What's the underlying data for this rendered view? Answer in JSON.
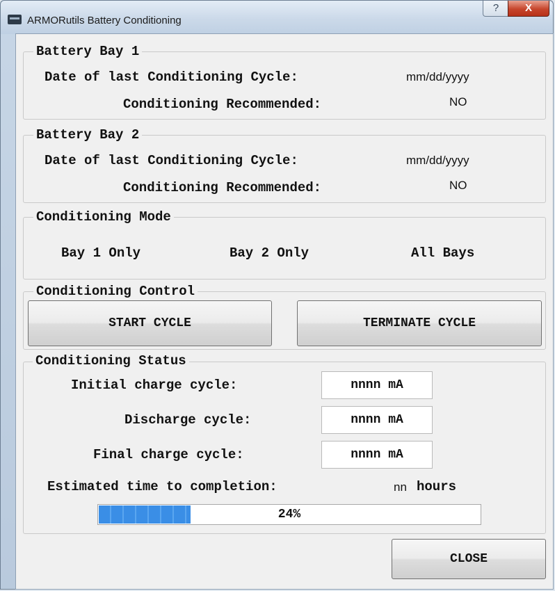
{
  "window": {
    "title": "ARMORutils Battery Conditioning",
    "help_glyph": "?",
    "close_glyph": "X"
  },
  "bay1": {
    "legend": "Battery Bay 1",
    "date_label": "Date of last Conditioning Cycle:",
    "date_value": "mm/dd/yyyy",
    "recommended_label": "Conditioning Recommended:",
    "recommended_value": "NO"
  },
  "bay2": {
    "legend": "Battery Bay 2",
    "date_label": "Date of last Conditioning Cycle:",
    "date_value": "mm/dd/yyyy",
    "recommended_label": "Conditioning Recommended:",
    "recommended_value": "NO"
  },
  "mode": {
    "legend": "Conditioning Mode",
    "options": [
      "Bay 1 Only",
      "Bay 2 Only",
      "All Bays"
    ]
  },
  "control": {
    "legend": "Conditioning Control",
    "start_label": "START CYCLE",
    "terminate_label": "TERMINATE CYCLE"
  },
  "status": {
    "legend": "Conditioning Status",
    "initial_label": "Initial charge cycle:",
    "initial_value": "nnnn mA",
    "discharge_label": "Discharge cycle:",
    "discharge_value": "nnnn mA",
    "final_label": "Final charge cycle:",
    "final_value": "nnnn mA",
    "eta_label": "Estimated time to completion:",
    "eta_value": "nn",
    "eta_unit": "hours",
    "progress_percent": 24,
    "progress_text": "24%"
  },
  "footer": {
    "close_label": "CLOSE"
  },
  "colors": {
    "progress_fill": "#3a8ee6",
    "close_button_red": "#c6452c"
  }
}
